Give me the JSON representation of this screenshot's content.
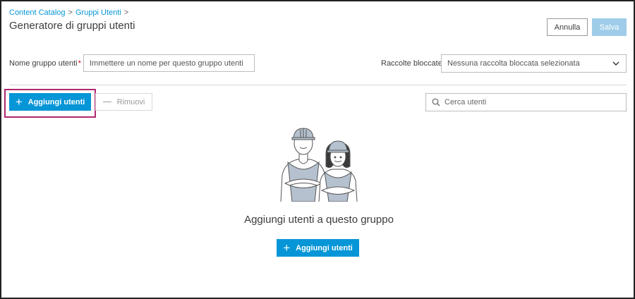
{
  "breadcrumb": {
    "items": [
      "Content Catalog",
      "Gruppi Utenti"
    ],
    "separator": ">"
  },
  "page": {
    "title": "Generatore di gruppi utenti"
  },
  "header_actions": {
    "cancel_label": "Annulla",
    "save_label": "Salva"
  },
  "form": {
    "name_label": "Nome gruppo utenti",
    "required_mark": "*",
    "name_placeholder": "Immettere un nome per questo gruppo utenti",
    "locked_label": "Raccolte bloccate",
    "locked_value": "Nessuna raccolta bloccata selezionata"
  },
  "toolbar": {
    "add_label": "Aggiungi utenti",
    "remove_label": "Rimuovi",
    "search_placeholder": "Cerca utenti"
  },
  "empty_state": {
    "message": "Aggiungi utenti a questo gruppo",
    "add_label": "Aggiungi utenti",
    "illustration": "two-workers-hardhats"
  },
  "colors": {
    "accent": "#0696d7",
    "disabled_accent": "#9fcde9",
    "highlight": "#b0286e",
    "required": "#d0021b"
  },
  "icons": {
    "plus": "plus-icon",
    "minus": "minus-icon",
    "search": "search-icon",
    "chevron": "chevron-down-icon"
  }
}
